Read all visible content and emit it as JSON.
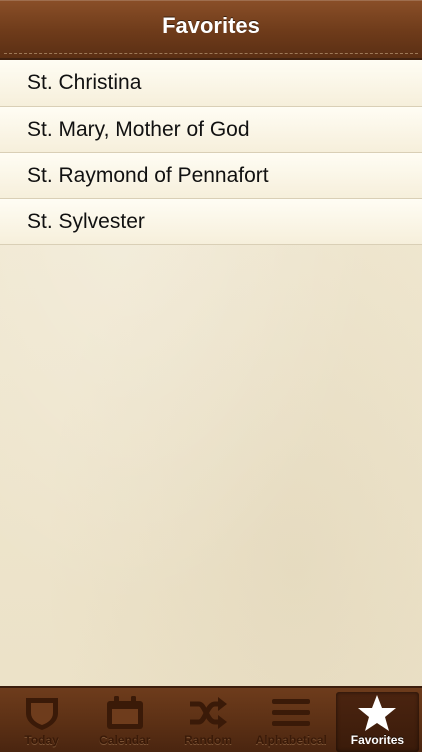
{
  "nav": {
    "title": "Favorites"
  },
  "favorites": [
    {
      "name": "St. Christina"
    },
    {
      "name": "St. Mary, Mother of God"
    },
    {
      "name": "St. Raymond of Pennafort"
    },
    {
      "name": "St. Sylvester"
    }
  ],
  "tabs": [
    {
      "label": "Today",
      "icon": "shield-icon",
      "active": false
    },
    {
      "label": "Calendar",
      "icon": "calendar-icon",
      "active": false
    },
    {
      "label": "Random",
      "icon": "shuffle-icon",
      "active": false
    },
    {
      "label": "Alphabetical",
      "icon": "list-icon",
      "active": false
    },
    {
      "label": "Favorites",
      "icon": "star-icon",
      "active": true
    }
  ],
  "colors": {
    "navbar": "#6e3b1a",
    "tabbar": "#5a2f14",
    "background": "#efe6cf"
  }
}
